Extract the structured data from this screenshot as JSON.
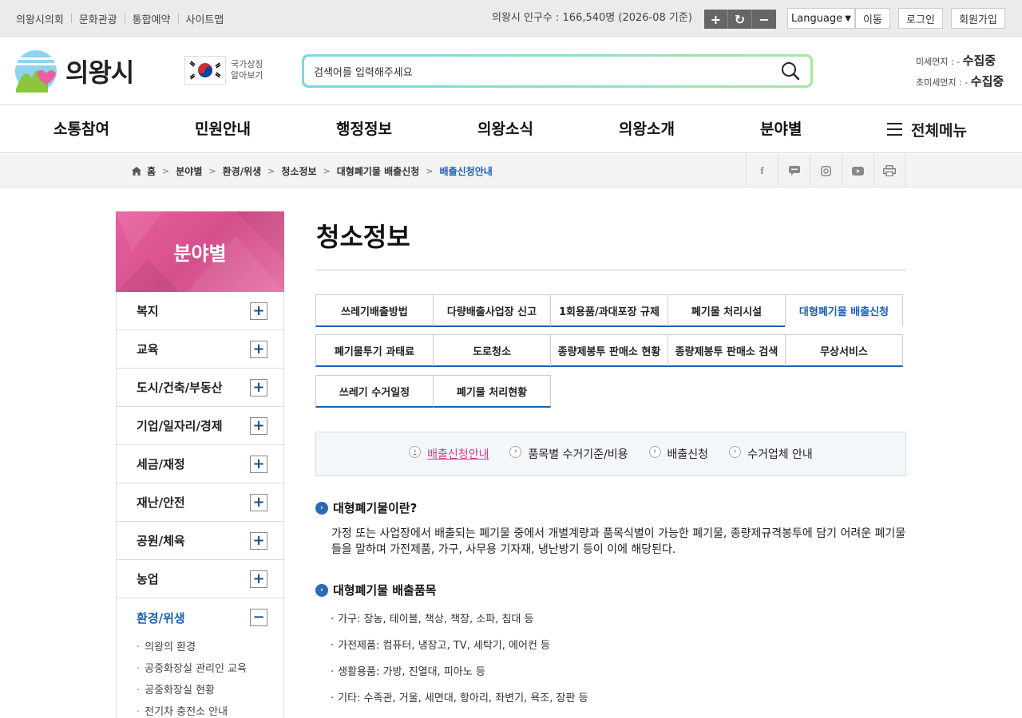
{
  "topbar": {
    "links": [
      "의왕시의회",
      "문화관광",
      "통합예약",
      "사이트맵"
    ],
    "population": "의왕시 인구수 : 166,540명 (2026-08 기준)",
    "zoom_in": "+",
    "zoom_reset": "↻",
    "zoom_out": "−",
    "language": "Language",
    "go": "이동",
    "login": "로그인",
    "signup": "회원가입"
  },
  "header": {
    "logo_text": "의왕시",
    "national_symbol_line1": "국가상징",
    "national_symbol_line2": "알아보기",
    "search_placeholder": "검색어를 입력해주세요",
    "fine_dust_label": "미세먼지 : -",
    "fine_dust_value": "수집중",
    "ultrafine_dust_label": "초미세먼지 : -",
    "ultrafine_dust_value": "수집중"
  },
  "gnb": {
    "items": [
      "소통참여",
      "민원안내",
      "행정정보",
      "의왕소식",
      "의왕소개",
      "분야별"
    ],
    "all_menu": "전체메뉴"
  },
  "breadcrumb": {
    "items": [
      "홈",
      "분야별",
      "환경/위생",
      "청소정보",
      "대형폐기물 배출신청",
      "배출신청안내"
    ]
  },
  "lnb": {
    "title": "분야별",
    "items": [
      "복지",
      "교육",
      "도시/건축/부동산",
      "기업/일자리/경제",
      "세금/재정",
      "재난/안전",
      "공원/체육",
      "농업",
      "환경/위생"
    ],
    "sub_items": [
      "의왕의 환경",
      "공중화장실 관리인 교육",
      "공중화장실 현황",
      "전기차 충전소 안내"
    ]
  },
  "content": {
    "title": "청소정보",
    "tabs": [
      "쓰레기배출방법",
      "다량배출사업장 신고",
      "1회용품/과대포장 규제",
      "폐기물 처리시설",
      "대형폐기물 배출신청",
      "폐기물투기 과태료",
      "도로청소",
      "종량제봉투 판매소 현황",
      "종량제봉투 판매소 검색",
      "무상서비스",
      "쓰레기 수거일정",
      "폐기물 처리현황"
    ],
    "subtabs": [
      "배출신청안내",
      "품목별 수거기준/비용",
      "배출신청",
      "수거업체 안내"
    ],
    "section1_title": "대형폐기물이란?",
    "section1_text": "가정 또는 사업장에서 배출되는 폐기물 중에서 개별계량과 품목식별이 가능한 폐기물, 종량제규격봉투에 담기 어려운 폐기물들을 말하며 가전제품, 가구, 사무용 기자재, 냉난방기 등이 이에 해당된다.",
    "section2_title": "대형폐기물 배출품목",
    "items": [
      "가구: 장농, 테이블, 책상, 책장, 소파, 침대 등",
      "가전제품: 컴퓨터, 냉장고, TV, 세탁기, 에어컨 등",
      "생활용품: 가방, 진열대, 피아노 등",
      "기타: 수족관, 거울, 세면대, 항아리, 좌변기, 욕조, 장판 등"
    ]
  },
  "colors": {
    "accent_blue": "#1a5fb4",
    "lnb_pink": "#e8609f",
    "active_subtab": "#d63d8a"
  }
}
